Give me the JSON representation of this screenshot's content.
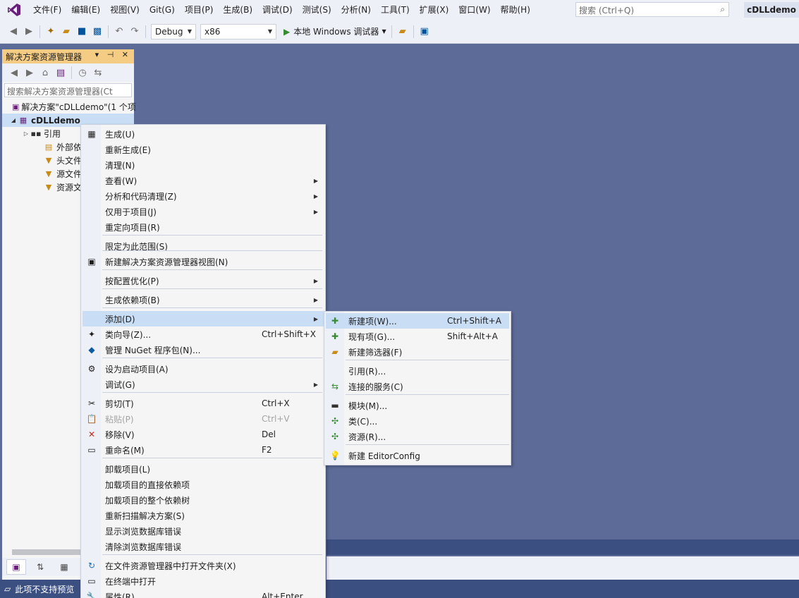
{
  "menubar": {
    "items": [
      "文件(F)",
      "编辑(E)",
      "视图(V)",
      "Git(G)",
      "项目(P)",
      "生成(B)",
      "调试(D)",
      "测试(S)",
      "分析(N)",
      "工具(T)",
      "扩展(X)",
      "窗口(W)",
      "帮助(H)"
    ],
    "search_placeholder": "搜索 (Ctrl+Q)",
    "solution_name": "cDLLdemo"
  },
  "toolbar": {
    "config": "Debug",
    "platform": "x86",
    "run_label": "本地 Windows 调试器"
  },
  "explorer": {
    "title": "解决方案资源管理器",
    "search_placeholder": "搜索解决方案资源管理器(Ct",
    "tree": [
      {
        "label": "解决方案\"cDLLdemo\"(1 个项",
        "bold": false,
        "expand": ""
      },
      {
        "label": "cDLLdemo",
        "bold": true,
        "expand": "◢"
      },
      {
        "label": "引用",
        "bold": false,
        "expand": "▷"
      },
      {
        "label": "外部依赖",
        "bold": false,
        "expand": ""
      },
      {
        "label": "头文件",
        "bold": false,
        "expand": ""
      },
      {
        "label": "源文件",
        "bold": false,
        "expand": ""
      },
      {
        "label": "资源文件",
        "bold": false,
        "expand": ""
      }
    ]
  },
  "context_menu": {
    "items": [
      {
        "label": "生成(U)",
        "key": "",
        "icon": "build-icon",
        "glyph": "▦",
        "submenu": false
      },
      {
        "label": "重新生成(E)",
        "key": "",
        "icon": "",
        "glyph": "",
        "submenu": false
      },
      {
        "label": "清理(N)",
        "key": "",
        "icon": "",
        "glyph": "",
        "submenu": false
      },
      {
        "label": "查看(W)",
        "key": "",
        "icon": "",
        "glyph": "",
        "submenu": true
      },
      {
        "label": "分析和代码清理(Z)",
        "key": "",
        "icon": "",
        "glyph": "",
        "submenu": true
      },
      {
        "label": "仅用于项目(J)",
        "key": "",
        "icon": "",
        "glyph": "",
        "submenu": true
      },
      {
        "label": "重定向项目(R)",
        "key": "",
        "icon": "",
        "glyph": "",
        "submenu": false
      },
      {
        "label": "限定为此范围(S)",
        "key": "",
        "icon": "",
        "glyph": "",
        "submenu": false
      },
      {
        "label": "新建解决方案资源管理器视图(N)",
        "key": "",
        "icon": "new-view-icon",
        "glyph": "▣",
        "submenu": false
      },
      {
        "label": "按配置优化(P)",
        "key": "",
        "icon": "",
        "glyph": "",
        "submenu": true
      },
      {
        "label": "生成依赖项(B)",
        "key": "",
        "icon": "",
        "glyph": "",
        "submenu": true
      },
      {
        "label": "添加(D)",
        "key": "",
        "icon": "",
        "glyph": "",
        "submenu": true
      },
      {
        "label": "类向导(Z)...",
        "key": "Ctrl+Shift+X",
        "icon": "class-wizard-icon",
        "glyph": "✦",
        "submenu": false
      },
      {
        "label": "管理 NuGet 程序包(N)...",
        "key": "",
        "icon": "nuget-icon",
        "glyph": "◆",
        "submenu": false
      },
      {
        "label": "设为启动项目(A)",
        "key": "",
        "icon": "gear-icon",
        "glyph": "⚙",
        "submenu": false
      },
      {
        "label": "调试(G)",
        "key": "",
        "icon": "",
        "glyph": "",
        "submenu": true
      },
      {
        "label": "剪切(T)",
        "key": "Ctrl+X",
        "icon": "scissors-icon",
        "glyph": "✂",
        "submenu": false
      },
      {
        "label": "粘贴(P)",
        "key": "Ctrl+V",
        "icon": "paste-icon",
        "glyph": "📋",
        "submenu": false
      },
      {
        "label": "移除(V)",
        "key": "Del",
        "icon": "remove-icon",
        "glyph": "✕",
        "submenu": false
      },
      {
        "label": "重命名(M)",
        "key": "F2",
        "icon": "rename-icon",
        "glyph": "▭",
        "submenu": false
      },
      {
        "label": "卸载项目(L)",
        "key": "",
        "icon": "",
        "glyph": "",
        "submenu": false
      },
      {
        "label": "加载项目的直接依赖项",
        "key": "",
        "icon": "",
        "glyph": "",
        "submenu": false
      },
      {
        "label": "加载项目的整个依赖树",
        "key": "",
        "icon": "",
        "glyph": "",
        "submenu": false
      },
      {
        "label": "重新扫描解决方案(S)",
        "key": "",
        "icon": "",
        "glyph": "",
        "submenu": false
      },
      {
        "label": "显示浏览数据库错误",
        "key": "",
        "icon": "",
        "glyph": "",
        "submenu": false
      },
      {
        "label": "清除浏览数据库错误",
        "key": "",
        "icon": "",
        "glyph": "",
        "submenu": false
      },
      {
        "label": "在文件资源管理器中打开文件夹(X)",
        "key": "",
        "icon": "open-folder-icon",
        "glyph": "↻",
        "submenu": false
      },
      {
        "label": "在终端中打开",
        "key": "",
        "icon": "terminal-icon",
        "glyph": "▭",
        "submenu": false
      },
      {
        "label": "属性(R)",
        "key": "Alt+Enter",
        "icon": "properties-icon",
        "glyph": "🔧",
        "submenu": false
      }
    ]
  },
  "add_submenu": {
    "items": [
      {
        "label": "新建项(W)...",
        "key": "Ctrl+Shift+A",
        "icon": "new-item-icon",
        "glyph": "✚"
      },
      {
        "label": "现有项(G)...",
        "key": "Shift+Alt+A",
        "icon": "existing-item-icon",
        "glyph": "✚"
      },
      {
        "label": "新建筛选器(F)",
        "key": "",
        "icon": "new-filter-icon",
        "glyph": "▰"
      },
      {
        "label": "引用(R)...",
        "key": "",
        "icon": "",
        "glyph": ""
      },
      {
        "label": "连接的服务(C)",
        "key": "",
        "icon": "connected-service-icon",
        "glyph": "⇆"
      },
      {
        "label": "模块(M)...",
        "key": "",
        "icon": "module-icon",
        "glyph": "▬"
      },
      {
        "label": "类(C)...",
        "key": "",
        "icon": "class-icon",
        "glyph": "✣"
      },
      {
        "label": "资源(R)...",
        "key": "",
        "icon": "resource-icon",
        "glyph": "✣"
      },
      {
        "label": "新建 EditorConfig",
        "key": "",
        "icon": "lightbulb-icon",
        "glyph": "💡"
      }
    ]
  },
  "statusbar": {
    "text": "此项不支持预览"
  },
  "colors": {
    "accent": "#68217a",
    "highlight": "#c9def5",
    "title_tab": "#f5cc84",
    "status": "#3c4f81",
    "background": "#5d6b99"
  }
}
